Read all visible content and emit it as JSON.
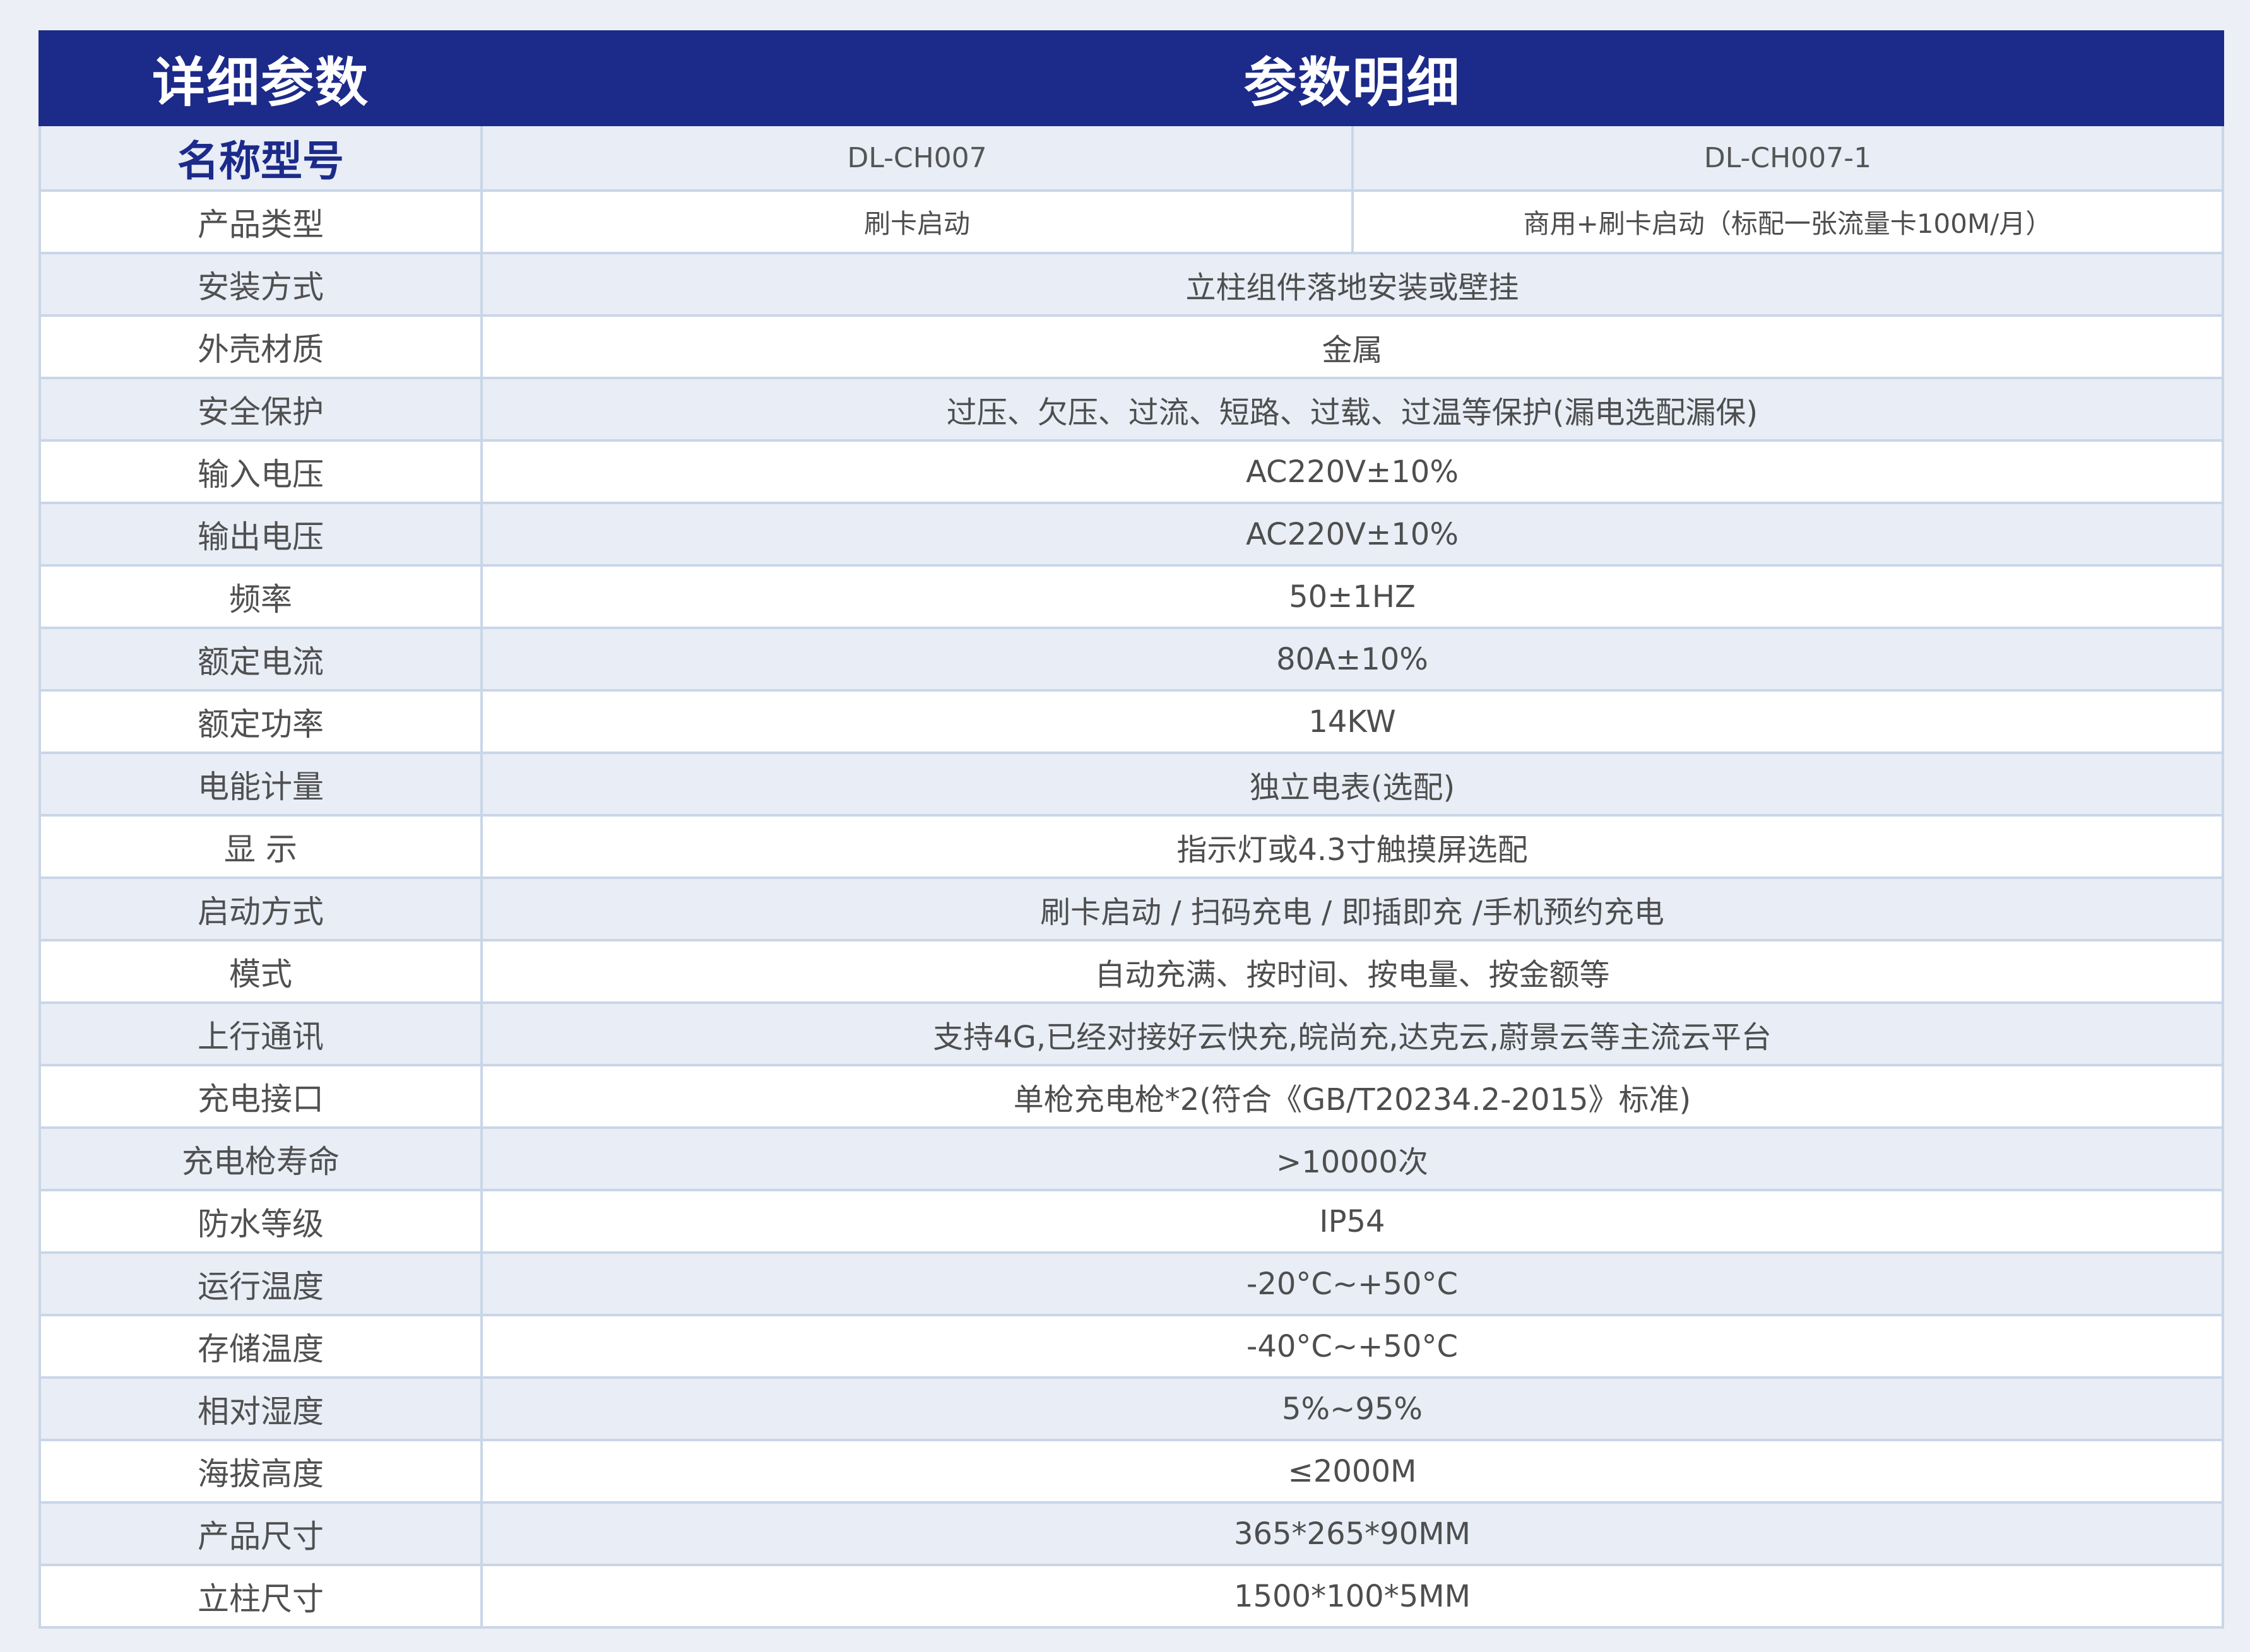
{
  "header": {
    "left_title": "详细参数",
    "right_title": "参数明细"
  },
  "model": {
    "label": "名称型号",
    "values": [
      "DL-CH007",
      "DL-CH007-1"
    ]
  },
  "product_type": {
    "label": "产品类型",
    "values": [
      "刷卡启动",
      "商用+刷卡启动（标配一张流量卡100M/月）"
    ]
  },
  "rows": [
    {
      "label": "安装方式",
      "value": "立柱组件落地安装或壁挂"
    },
    {
      "label": "外壳材质",
      "value": "金属"
    },
    {
      "label": "安全保护",
      "value": "过压、欠压、过流、短路、过载、过温等保护(漏电选配漏保)"
    },
    {
      "label": "输入电压",
      "value": "AC220V±10%"
    },
    {
      "label": "输出电压",
      "value": "AC220V±10%"
    },
    {
      "label": "频率",
      "value": "50±1HZ"
    },
    {
      "label": "额定电流",
      "value": "80A±10%"
    },
    {
      "label": "额定功率",
      "value": "14KW"
    },
    {
      "label": "电能计量",
      "value": "独立电表(选配)"
    },
    {
      "label": "显 示",
      "value": "指示灯或4.3寸触摸屏选配"
    },
    {
      "label": "启动方式",
      "value": "刷卡启动 / 扫码充电 / 即插即充 /手机预约充电"
    },
    {
      "label": "模式",
      "value": "自动充满、按时间、按电量、按金额等"
    },
    {
      "label": "上行通讯",
      "value": "支持4G,已经对接好云快充,皖尚充,达克云,蔚景云等主流云平台"
    },
    {
      "label": "充电接口",
      "value": "单枪充电枪*2(符合《GB/T20234.2-2015》标准)"
    },
    {
      "label": "充电枪寿命",
      "value": ">10000次"
    },
    {
      "label": "防水等级",
      "value": "IP54"
    },
    {
      "label": "运行温度",
      "value": "-20°C~+50°C"
    },
    {
      "label": "存储温度",
      "value": "-40°C~+50°C"
    },
    {
      "label": "相对湿度",
      "value": "5%~95%"
    },
    {
      "label": "海拔高度",
      "value": "≤2000M"
    },
    {
      "label": "产品尺寸",
      "value": "365*265*90MM"
    },
    {
      "label": "立柱尺寸",
      "value": "1500*100*5MM"
    }
  ],
  "colors": {
    "header_bg": "#1c2a8a",
    "border": "#c9d6e8",
    "alt_row_bg": "#e8edf6",
    "page_bg": "#eceff5"
  }
}
